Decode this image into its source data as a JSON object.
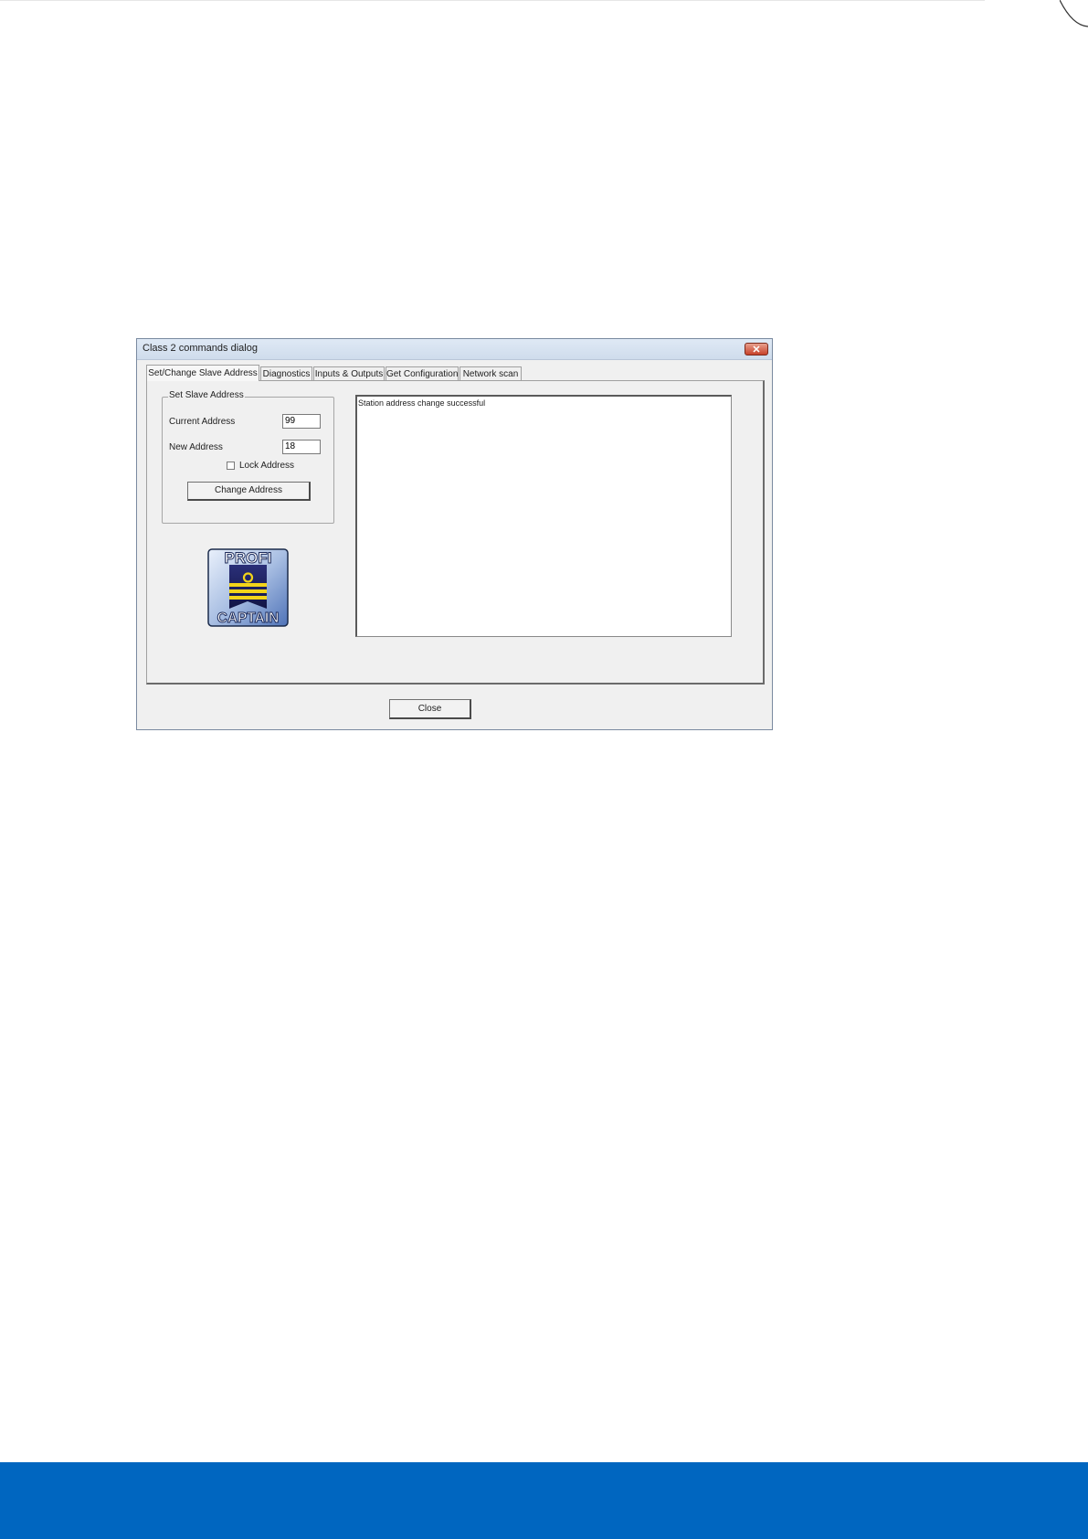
{
  "dialog": {
    "title": "Class 2 commands dialog",
    "close_glyph": "✕",
    "tabs": [
      {
        "label": "Set/Change Slave Address",
        "active": true
      },
      {
        "label": "Diagnostics",
        "active": false
      },
      {
        "label": "Inputs & Outputs",
        "active": false
      },
      {
        "label": "Get Configuration",
        "active": false
      },
      {
        "label": "Network scan",
        "active": false
      }
    ],
    "group": {
      "legend": "Set Slave Address",
      "current_address_label": "Current Address",
      "current_address_value": "99",
      "new_address_label": "New Address",
      "new_address_value": "18",
      "lock_address_label": "Lock Address",
      "lock_address_checked": false,
      "change_button": "Change Address"
    },
    "logo": {
      "text_top": "PROFI",
      "text_bottom": "CAPTAIN"
    },
    "output_text": "Station address change successful",
    "close_button": "Close"
  },
  "colors": {
    "bottom_band": "#0066c0"
  }
}
